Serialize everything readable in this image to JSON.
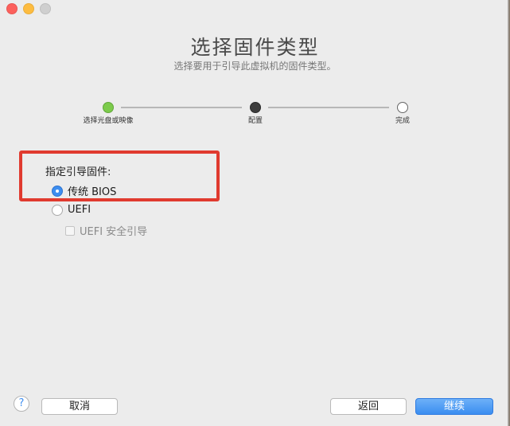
{
  "window": {
    "buttons": [
      "close",
      "minimize",
      "zoom"
    ]
  },
  "header": {
    "title": "选择固件类型",
    "subtitle": "选择要用于引导此虚拟机的固件类型。"
  },
  "steps": [
    {
      "label": "选择光盘或映像",
      "state": "complete",
      "color": "#7ccb4b"
    },
    {
      "label": "配置",
      "state": "current",
      "color": "#3d3d3d"
    },
    {
      "label": "完成",
      "state": "pending",
      "color": "#ffffff"
    }
  ],
  "firmware": {
    "section_label": "指定引导固件:",
    "options": [
      {
        "label": "传统 BIOS",
        "selected": true
      },
      {
        "label": "UEFI",
        "selected": false
      }
    ],
    "secure_boot": {
      "label": "UEFI 安全引导",
      "checked": false,
      "enabled": false
    }
  },
  "highlight_color": "#e03a2f",
  "footer": {
    "help_icon": "?",
    "cancel_label": "取消",
    "back_label": "返回",
    "continue_label": "继续",
    "accent": "#3a8ef0"
  }
}
